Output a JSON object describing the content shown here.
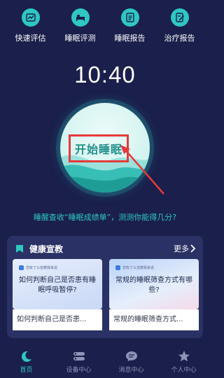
{
  "top_nav": [
    {
      "label": "快速评估",
      "icon": "trend-chart-icon"
    },
    {
      "label": "睡眠评测",
      "icon": "bed-icon"
    },
    {
      "label": "睡眠报告",
      "icon": "report-list-icon"
    },
    {
      "label": "治疗报告",
      "icon": "edit-report-icon"
    }
  ],
  "clock": "10:40",
  "start_button": {
    "label": "开始睡眠"
  },
  "promo_text": "睡醒查收“睡眠成绩单”，测测你能得几分?",
  "health_card": {
    "title": "健康宣教",
    "more_label": "更多",
    "articles": [
      {
        "thumb_tag": "您有了么宣教我来说",
        "thumb_text": "如何判断自己是否患有睡眠呼吸暂停?",
        "caption": "如何判断自己是否患..."
      },
      {
        "thumb_tag": "您有了么宣教我来说",
        "thumb_text": "常规的睡眠筛查方式有哪些?",
        "caption": "常规的睡眠筛查方式..."
      }
    ]
  },
  "tab_bar": [
    {
      "label": "首页",
      "icon": "moon-icon",
      "active": true
    },
    {
      "label": "设备中心",
      "icon": "device-icon",
      "active": false
    },
    {
      "label": "消息中心",
      "icon": "message-icon",
      "active": false
    },
    {
      "label": "个人中心",
      "icon": "star-icon",
      "active": false
    }
  ],
  "colors": {
    "background": "#1a1f4b",
    "accent": "#2fc7bf",
    "card": "#2a3164",
    "highlight_box": "#e63a3a",
    "tab_inactive": "#8e94b8"
  }
}
